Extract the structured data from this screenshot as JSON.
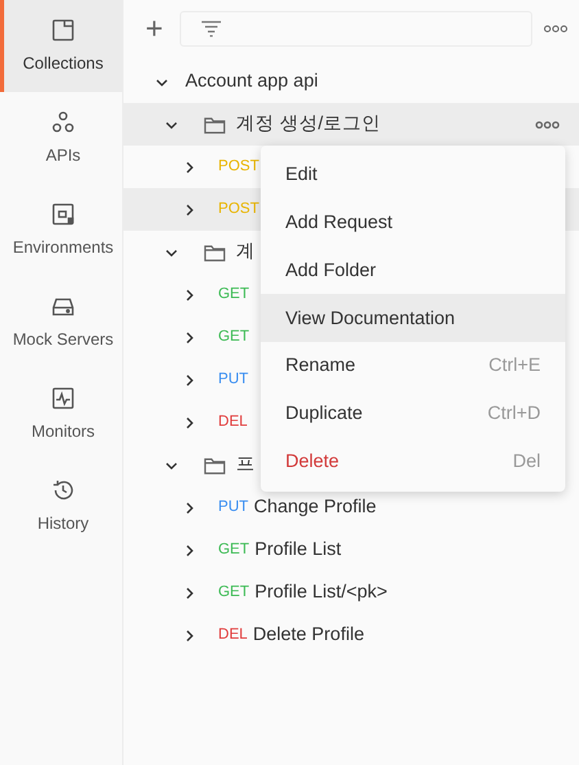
{
  "sidebar": {
    "items": [
      {
        "label": "Collections",
        "selected": true
      },
      {
        "label": "APIs",
        "selected": false
      },
      {
        "label": "Environments",
        "selected": false
      },
      {
        "label": "Mock Servers",
        "selected": false
      },
      {
        "label": "Monitors",
        "selected": false
      },
      {
        "label": "History",
        "selected": false
      }
    ]
  },
  "toolbar": {
    "add": "+"
  },
  "tree": [
    {
      "kind": "collection",
      "name": "Account app api",
      "expanded": true,
      "highlighted": false,
      "children": [
        {
          "kind": "folder",
          "name": "계정 생성/로그인",
          "expanded": true,
          "highlighted": true,
          "children": [
            {
              "kind": "request",
              "method": "POST",
              "expanded": false,
              "highlighted": false
            },
            {
              "kind": "request",
              "method": "POST",
              "expanded": false,
              "highlighted": true
            }
          ]
        },
        {
          "kind": "folder",
          "name": "계",
          "expanded": true,
          "highlighted": false,
          "children": [
            {
              "kind": "request",
              "method": "GET",
              "expanded": false,
              "highlighted": false
            },
            {
              "kind": "request",
              "method": "GET",
              "expanded": false,
              "highlighted": false
            },
            {
              "kind": "request",
              "method": "PUT",
              "expanded": false,
              "highlighted": false
            },
            {
              "kind": "request",
              "method": "DEL",
              "expanded": false,
              "highlighted": false
            }
          ]
        },
        {
          "kind": "folder",
          "name": "프",
          "expanded": true,
          "highlighted": false,
          "children": [
            {
              "kind": "request",
              "method": "PUT",
              "name": "Change Profile",
              "expanded": false,
              "highlighted": false
            },
            {
              "kind": "request",
              "method": "GET",
              "name": "Profile List",
              "expanded": false,
              "highlighted": false
            },
            {
              "kind": "request",
              "method": "GET",
              "name": "Profile List/<pk>",
              "expanded": false,
              "highlighted": false
            },
            {
              "kind": "request",
              "method": "DEL",
              "name": "Delete Profile",
              "expanded": false,
              "highlighted": false
            }
          ]
        }
      ]
    }
  ],
  "context_menu": {
    "items": [
      {
        "label": "Edit",
        "kind": "normal",
        "highlighted": false
      },
      {
        "label": "Add Request",
        "kind": "normal",
        "highlighted": false
      },
      {
        "label": "Add Folder",
        "kind": "normal",
        "highlighted": false
      },
      {
        "label": "View Documentation",
        "kind": "normal",
        "highlighted": true
      },
      {
        "label": "Rename",
        "shortcut": "Ctrl+E",
        "kind": "normal",
        "highlighted": false
      },
      {
        "label": "Duplicate",
        "shortcut": "Ctrl+D",
        "kind": "normal",
        "highlighted": false
      },
      {
        "label": "Delete",
        "shortcut": "Del",
        "kind": "danger",
        "highlighted": false
      }
    ]
  }
}
